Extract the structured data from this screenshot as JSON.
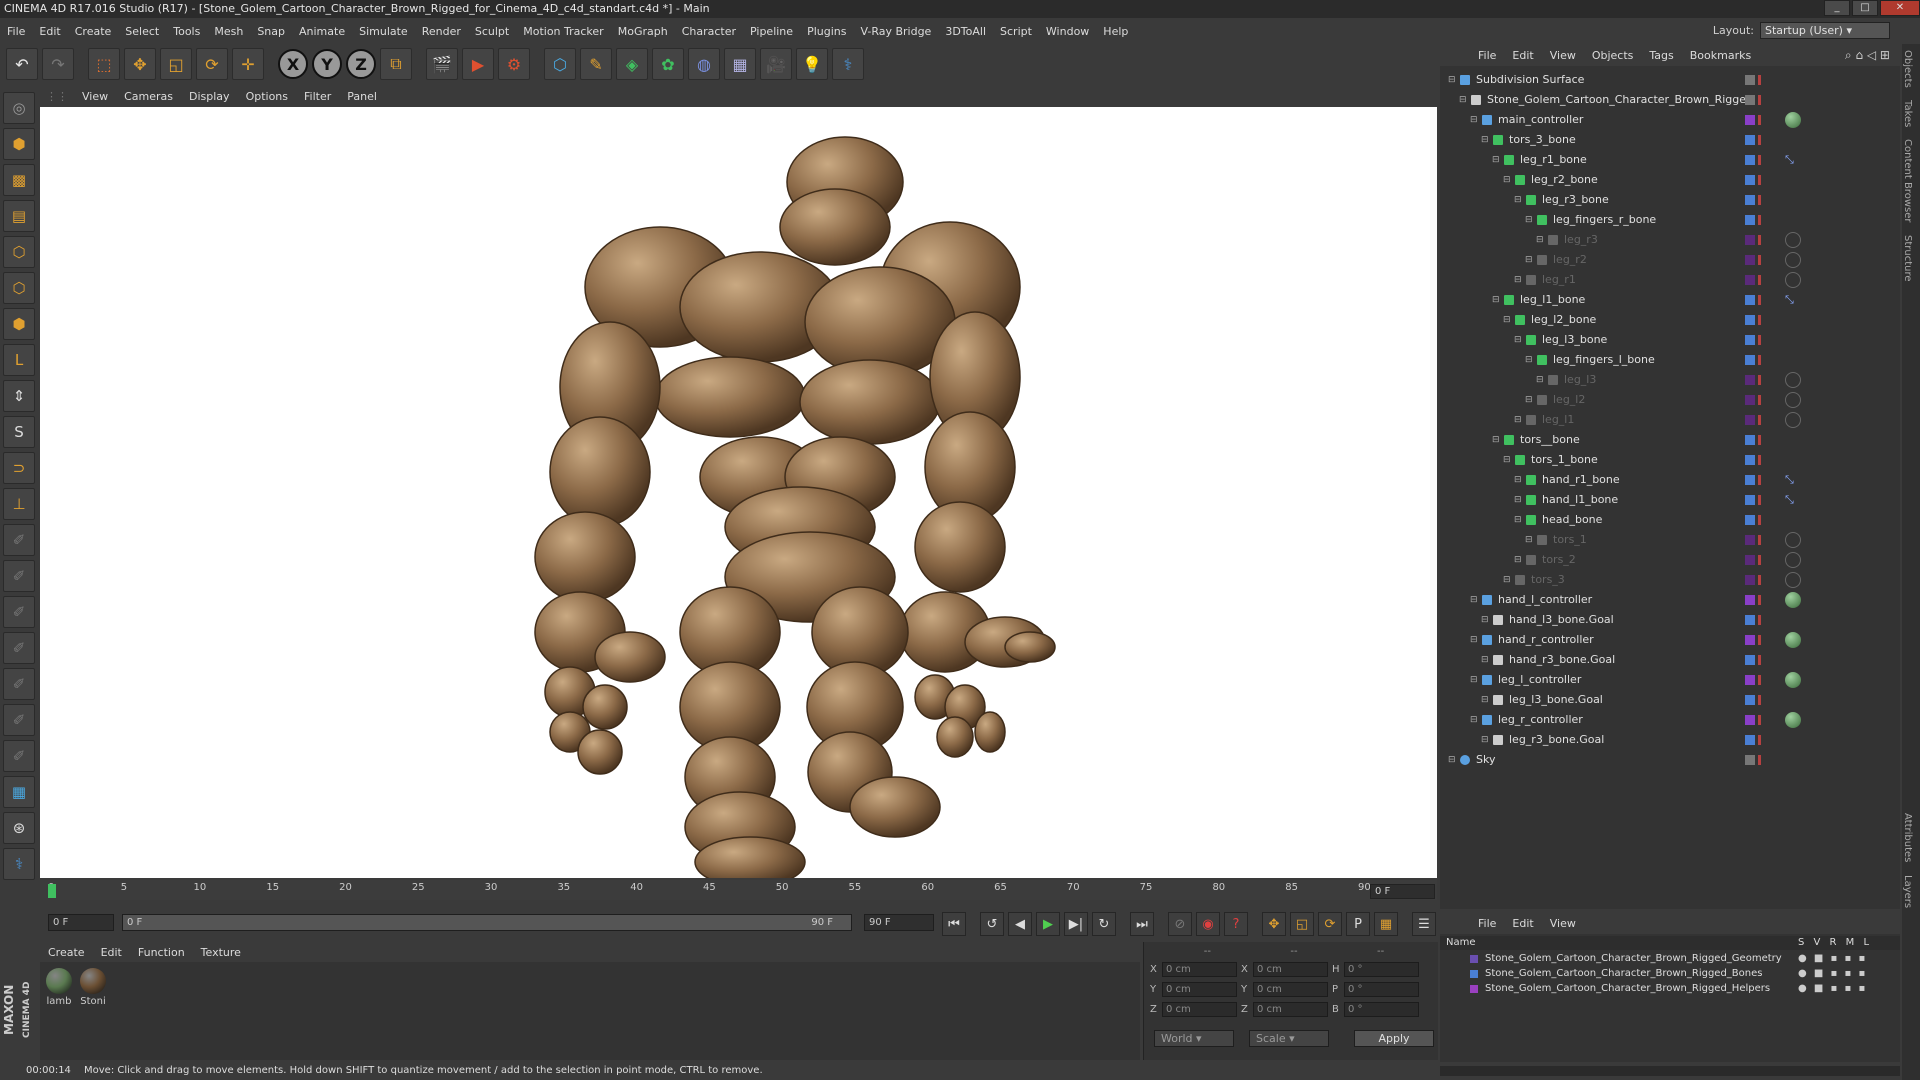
{
  "window": {
    "title": "CINEMA 4D R17.016 Studio (R17) - [Stone_Golem_Cartoon_Character_Brown_Rigged_for_Cinema_4D_c4d_standart.c4d *] - Main"
  },
  "menubar": [
    "File",
    "Edit",
    "Create",
    "Select",
    "Tools",
    "Mesh",
    "Snap",
    "Animate",
    "Simulate",
    "Render",
    "Sculpt",
    "Motion Tracker",
    "MoGraph",
    "Character",
    "Pipeline",
    "Plugins",
    "V-Ray Bridge",
    "3DToAll",
    "Script",
    "Window",
    "Help"
  ],
  "layout": {
    "label": "Layout:",
    "value": "Startup (User)"
  },
  "toolbar": {
    "axis_x": "X",
    "axis_y": "Y",
    "axis_z": "Z"
  },
  "viewport_menu": [
    "View",
    "Cameras",
    "Display",
    "Options",
    "Filter",
    "Panel"
  ],
  "timeline": {
    "ticks": [
      "0",
      "5",
      "10",
      "15",
      "20",
      "25",
      "30",
      "35",
      "40",
      "45",
      "50",
      "55",
      "60",
      "65",
      "70",
      "75",
      "80",
      "85",
      "90"
    ],
    "current_frame": "0 F"
  },
  "transport": {
    "start": "0 F",
    "range_start": "0 F",
    "range_end": "90 F",
    "end": "90 F"
  },
  "material_menu": [
    "Create",
    "Edit",
    "Function",
    "Texture"
  ],
  "materials": [
    {
      "name": "lamb",
      "color": "#5a7a50"
    },
    {
      "name": "Stoni",
      "color": "#6b4f33"
    }
  ],
  "coords": {
    "header_dashes": [
      "--",
      "--",
      "--"
    ],
    "rows": [
      {
        "a": "X",
        "av": "0 cm",
        "b": "X",
        "bv": "0 cm",
        "c": "H",
        "cv": "0 °"
      },
      {
        "a": "Y",
        "av": "0 cm",
        "b": "Y",
        "bv": "0 cm",
        "c": "P",
        "cv": "0 °"
      },
      {
        "a": "Z",
        "av": "0 cm",
        "b": "Z",
        "bv": "0 cm",
        "c": "B",
        "cv": "0 °"
      }
    ],
    "mode": "World",
    "mode2": "Scale",
    "apply": "Apply"
  },
  "status": {
    "time": "00:00:14",
    "message": "Move: Click and drag to move elements. Hold down SHIFT to quantize movement / add to the selection in point mode, CTRL to remove."
  },
  "object_menu": [
    "File",
    "Edit",
    "View",
    "Objects",
    "Tags",
    "Bookmarks"
  ],
  "objects": [
    {
      "name": "Subdivision Surface",
      "indent": 0,
      "dim": false,
      "tag": ""
    },
    {
      "name": "Stone_Golem_Cartoon_Character_Brown_Rigged",
      "indent": 1,
      "dim": false,
      "tag": ""
    },
    {
      "name": "main_controller",
      "indent": 2,
      "dim": false,
      "tag": "green"
    },
    {
      "name": "tors_3_bone",
      "indent": 3,
      "dim": false,
      "tag": ""
    },
    {
      "name": "leg_r1_bone",
      "indent": 4,
      "dim": false,
      "tag": "ik"
    },
    {
      "name": "leg_r2_bone",
      "indent": 5,
      "dim": false,
      "tag": ""
    },
    {
      "name": "leg_r3_bone",
      "indent": 6,
      "dim": false,
      "tag": ""
    },
    {
      "name": "leg_fingers_r_bone",
      "indent": 7,
      "dim": false,
      "tag": ""
    },
    {
      "name": "leg_r3",
      "indent": 8,
      "dim": true,
      "tag": "grey"
    },
    {
      "name": "leg_r2",
      "indent": 7,
      "dim": true,
      "tag": "grey"
    },
    {
      "name": "leg_r1",
      "indent": 6,
      "dim": true,
      "tag": "grey"
    },
    {
      "name": "leg_l1_bone",
      "indent": 4,
      "dim": false,
      "tag": "ik"
    },
    {
      "name": "leg_l2_bone",
      "indent": 5,
      "dim": false,
      "tag": ""
    },
    {
      "name": "leg_l3_bone",
      "indent": 6,
      "dim": false,
      "tag": ""
    },
    {
      "name": "leg_fingers_l_bone",
      "indent": 7,
      "dim": false,
      "tag": ""
    },
    {
      "name": "leg_l3",
      "indent": 8,
      "dim": true,
      "tag": "grey"
    },
    {
      "name": "leg_l2",
      "indent": 7,
      "dim": true,
      "tag": "grey"
    },
    {
      "name": "leg_l1",
      "indent": 6,
      "dim": true,
      "tag": "grey"
    },
    {
      "name": "tors__bone",
      "indent": 4,
      "dim": false,
      "tag": ""
    },
    {
      "name": "tors_1_bone",
      "indent": 5,
      "dim": false,
      "tag": ""
    },
    {
      "name": "hand_r1_bone",
      "indent": 6,
      "dim": false,
      "tag": "ik"
    },
    {
      "name": "hand_l1_bone",
      "indent": 6,
      "dim": false,
      "tag": "ik"
    },
    {
      "name": "head_bone",
      "indent": 6,
      "dim": false,
      "tag": ""
    },
    {
      "name": "tors_1",
      "indent": 7,
      "dim": true,
      "tag": "grey"
    },
    {
      "name": "tors_2",
      "indent": 6,
      "dim": true,
      "tag": "grey"
    },
    {
      "name": "tors_3",
      "indent": 5,
      "dim": true,
      "tag": "grey"
    },
    {
      "name": "hand_l_controller",
      "indent": 2,
      "dim": false,
      "tag": "green"
    },
    {
      "name": "hand_l3_bone.Goal",
      "indent": 3,
      "dim": false,
      "tag": ""
    },
    {
      "name": "hand_r_controller",
      "indent": 2,
      "dim": false,
      "tag": "green"
    },
    {
      "name": "hand_r3_bone.Goal",
      "indent": 3,
      "dim": false,
      "tag": ""
    },
    {
      "name": "leg_l_controller",
      "indent": 2,
      "dim": false,
      "tag": "green"
    },
    {
      "name": "leg_l3_bone.Goal",
      "indent": 3,
      "dim": false,
      "tag": ""
    },
    {
      "name": "leg_r_controller",
      "indent": 2,
      "dim": false,
      "tag": "green"
    },
    {
      "name": "leg_r3_bone.Goal",
      "indent": 3,
      "dim": false,
      "tag": ""
    },
    {
      "name": "Sky",
      "indent": 0,
      "dim": false,
      "tag": ""
    }
  ],
  "layer_menu": [
    "File",
    "Edit",
    "View"
  ],
  "layer_header": {
    "name": "Name",
    "cols": "S V R M L"
  },
  "layers": [
    {
      "name": "Stone_Golem_Cartoon_Character_Brown_Rigged_Geometry",
      "color": "#6a4fb0"
    },
    {
      "name": "Stone_Golem_Cartoon_Character_Brown_Rigged_Bones",
      "color": "#4a7fd4"
    },
    {
      "name": "Stone_Golem_Cartoon_Character_Brown_Rigged_Helpers",
      "color": "#9a40c0"
    }
  ],
  "side_tabs": [
    "Objects",
    "Takes",
    "Content Browser",
    "Structure",
    "Attributes",
    "Layers"
  ],
  "logo": {
    "line1": "MAXON",
    "line2": "CINEMA 4D"
  }
}
